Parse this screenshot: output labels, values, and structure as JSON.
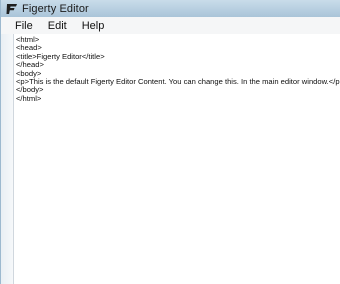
{
  "window": {
    "title": "Figerty Editor",
    "icon": "figerty-logo-icon"
  },
  "menu": {
    "items": [
      "File",
      "Edit",
      "Help"
    ]
  },
  "editor": {
    "lines": [
      "<html>",
      "<head>",
      "<title>Figerty Editor</title>",
      "</head>",
      "<body>",
      "<p>This is the default Figerty Editor Content. You can change this. In the main editor window.</p>",
      "</body>",
      "</html>"
    ]
  },
  "colors": {
    "titlebar": "#b4cde0",
    "background": "#ffffff",
    "text": "#111111"
  }
}
